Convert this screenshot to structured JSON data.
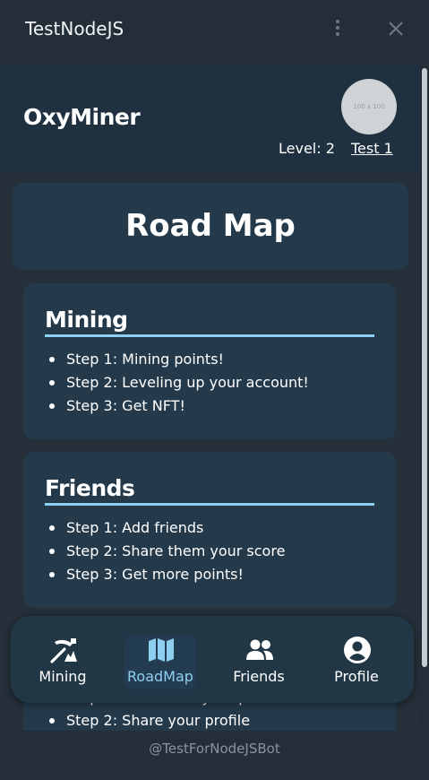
{
  "window": {
    "title": "TestNodeJS"
  },
  "header": {
    "brand": "OxyMiner",
    "avatar_placeholder": "100 x 100",
    "level_text": "Level: 2",
    "username": "Test 1"
  },
  "page": {
    "title": "Road Map"
  },
  "sections": [
    {
      "title": "Mining",
      "steps": [
        "Step 1: Mining points!",
        "Step 2: Leveling up your account!",
        "Step 3: Get NFT!"
      ]
    },
    {
      "title": "Friends",
      "steps": [
        "Step 1: Add friends",
        "Step 2: Share them your score",
        "Step 3: Get more points!"
      ]
    },
    {
      "title": "",
      "steps": [
        "Step 1: Customize your profile",
        "Step 2: Share your profile"
      ]
    }
  ],
  "nav": {
    "items": [
      {
        "label": "Mining",
        "icon": "pickaxe-icon"
      },
      {
        "label": "RoadMap",
        "icon": "map-icon"
      },
      {
        "label": "Friends",
        "icon": "users-icon"
      },
      {
        "label": "Profile",
        "icon": "user-circle-icon"
      }
    ],
    "active": "RoadMap"
  },
  "footer": {
    "bot_handle": "@TestForNodeJSBot"
  },
  "colors": {
    "background": "#25303a",
    "card": "#243a4b",
    "accent": "#8ed0f1",
    "header": "#1f3140"
  }
}
